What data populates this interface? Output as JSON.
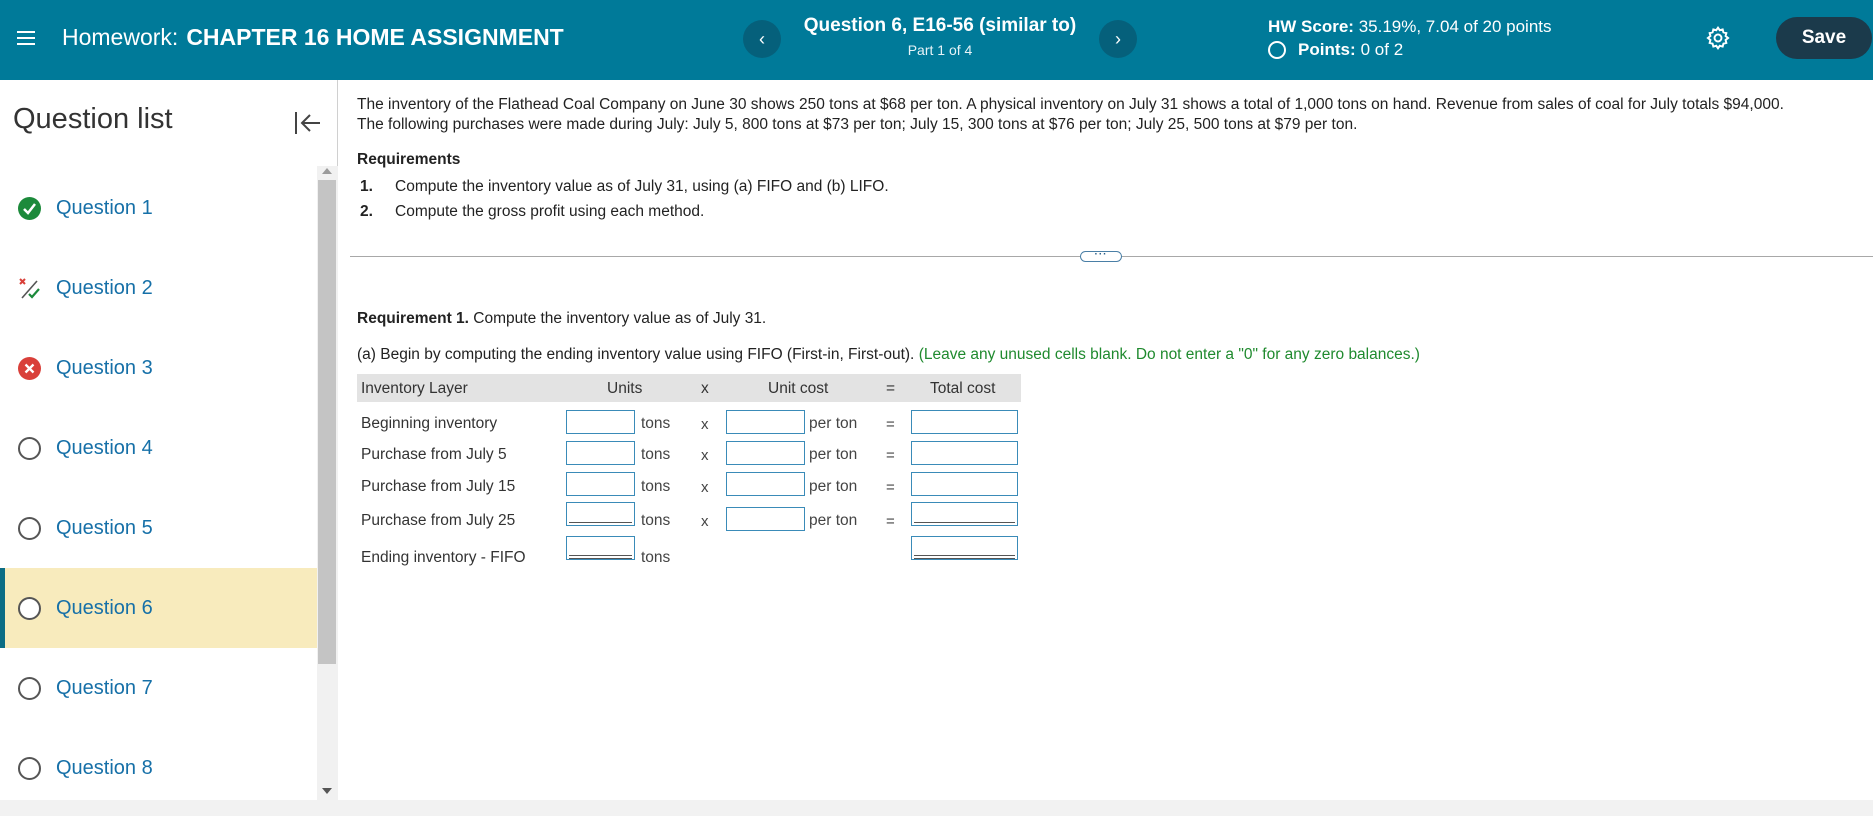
{
  "header": {
    "homework_prefix": "Homework:",
    "homework_name": "CHAPTER 16 HOME ASSIGNMENT",
    "prev_label": "‹",
    "next_label": "›",
    "question_title": "Question 6, E16-56 (similar to)",
    "question_part": "Part 1 of 4",
    "hw_score_label": "HW Score:",
    "hw_score_value": "35.19%, 7.04 of 20 points",
    "points_label": "Points:",
    "points_value": "0 of 2",
    "save_label": "Save"
  },
  "sidebar": {
    "title": "Question list",
    "items": [
      {
        "label": "Question 1",
        "status": "correct"
      },
      {
        "label": "Question 2",
        "status": "partial"
      },
      {
        "label": "Question 3",
        "status": "incorrect"
      },
      {
        "label": "Question 4",
        "status": "empty"
      },
      {
        "label": "Question 5",
        "status": "empty"
      },
      {
        "label": "Question 6",
        "status": "empty",
        "active": true
      },
      {
        "label": "Question 7",
        "status": "empty"
      },
      {
        "label": "Question 8",
        "status": "empty"
      }
    ]
  },
  "problem": {
    "text_line1": "The inventory of the Flathead Coal Company on June 30 shows 250 tons at $68 per ton. A physical inventory on July 31 shows a total of 1,000 tons on hand. Revenue from sales of coal for July totals $94,000.",
    "text_line2": "The following purchases were made during July: July 5, 800 tons at $73 per ton; July 15, 300 tons at $76 per ton; July 25, 500 tons at $79 per ton.",
    "requirements_heading": "Requirements",
    "requirements": [
      {
        "num": "1.",
        "text": "Compute the inventory value as of July 31, using (a) FIFO and (b) LIFO."
      },
      {
        "num": "2.",
        "text": "Compute the gross profit using each method."
      }
    ],
    "more_label": "···"
  },
  "requirement1": {
    "label": "Requirement 1.",
    "text": "Compute the inventory value as of July 31.",
    "fifo_text": "(a) Begin by computing the ending inventory value using FIFO (First-in, First-out).",
    "fifo_hint": "(Leave any unused cells blank. Do not enter a \"0\" for any zero balances.)"
  },
  "table": {
    "headers": {
      "layer": "Inventory Layer",
      "units": "Units",
      "x": "x",
      "unit_cost": "Unit cost",
      "eq": "=",
      "total": "Total cost"
    },
    "rows": [
      {
        "label": "Beginning inventory",
        "units_word": "tons",
        "x": "x",
        "per": "per ton",
        "eq": "="
      },
      {
        "label": "Purchase from July 5",
        "units_word": "tons",
        "x": "x",
        "per": "per ton",
        "eq": "="
      },
      {
        "label": "Purchase from July 15",
        "units_word": "tons",
        "x": "x",
        "per": "per ton",
        "eq": "="
      },
      {
        "label": "Purchase from July 25",
        "units_word": "tons",
        "x": "x",
        "per": "per ton",
        "eq": "="
      }
    ],
    "total_row": {
      "label": "Ending inventory - FIFO",
      "units_word": "tons"
    }
  }
}
